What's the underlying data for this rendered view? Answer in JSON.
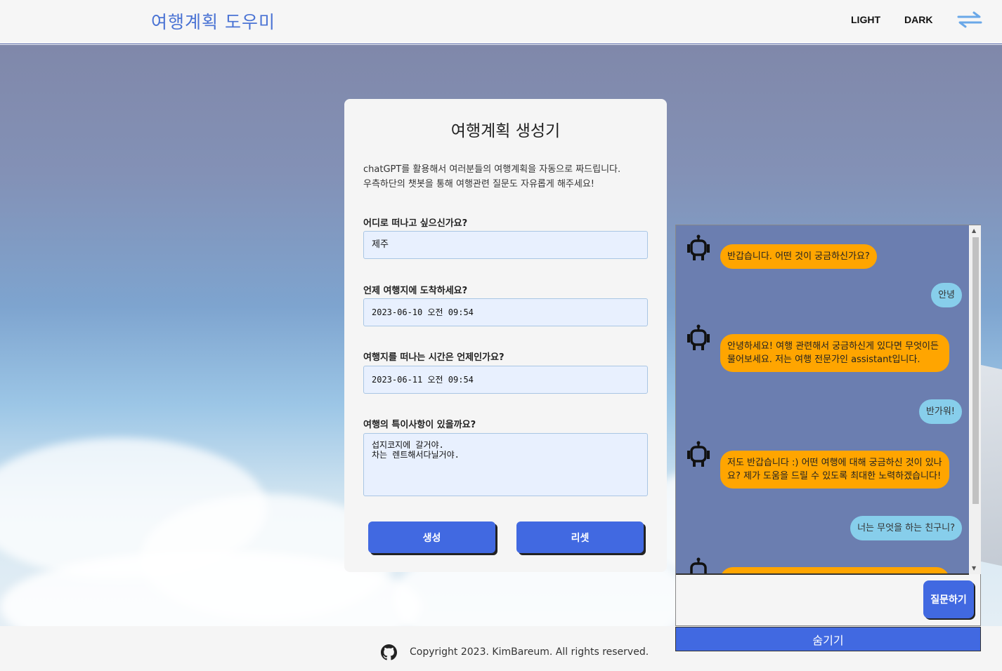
{
  "header": {
    "logo": "여행계획 도우미",
    "light_label": "LIGHT",
    "dark_label": "DARK",
    "menu_icon": "swap-arrows-icon"
  },
  "form": {
    "title": "여행계획 생성기",
    "description_line1": "chatGPT를 활용해서 여러분들의 여행계획을 자동으로 짜드립니다.",
    "description_line2": "우측하단의 챗봇을 통해 여행관련 질문도 자유롭게 해주세요!",
    "destination_label": "어디로 떠나고 싶으신가요?",
    "destination_value": "제주",
    "arrival_label": "언제 여행지에 도착하세요?",
    "arrival_value": "2023-06-10 오전 09:54",
    "departure_label": "여행지를 떠나는 시간은 언제인가요?",
    "departure_value": "2023-06-11 오전 09:54",
    "notes_label": "여행의 특이사항이 있을까요?",
    "notes_value": "섭지코지에 갈거야.\n차는 렌트해서다닐거야.",
    "generate_label": "생성",
    "reset_label": "리셋"
  },
  "chat": {
    "messages": [
      {
        "role": "bot",
        "text": "반갑습니다. 어떤 것이 궁금하신가요?"
      },
      {
        "role": "user",
        "text": "안녕"
      },
      {
        "role": "bot",
        "text": "안녕하세요! 여행 관련해서 궁금하신게 있다면 무엇이든 물어보세요. 저는 여행 전문가인 assistant입니다."
      },
      {
        "role": "user",
        "text": "반가워!"
      },
      {
        "role": "bot",
        "text": "저도 반갑습니다 :) 어떤 여행에 대해 궁금하신 것이 있나요? 제가 도움을 드릴 수 있도록 최대한 노력하겠습니다!"
      },
      {
        "role": "user",
        "text": "너는 무엇을 하는 친구니?"
      }
    ],
    "input_value": "",
    "ask_label": "질문하기",
    "hide_label": "숨기기"
  },
  "footer": {
    "copyright": "Copyright 2023. KimBareum. All rights reserved.",
    "github_icon": "github-icon"
  },
  "colors": {
    "accent": "#4169e1",
    "bot_bubble": "#ffa500",
    "user_bubble": "#87ceeb",
    "chat_bg": "#6b7eb0",
    "logo": "#4a73d4"
  }
}
